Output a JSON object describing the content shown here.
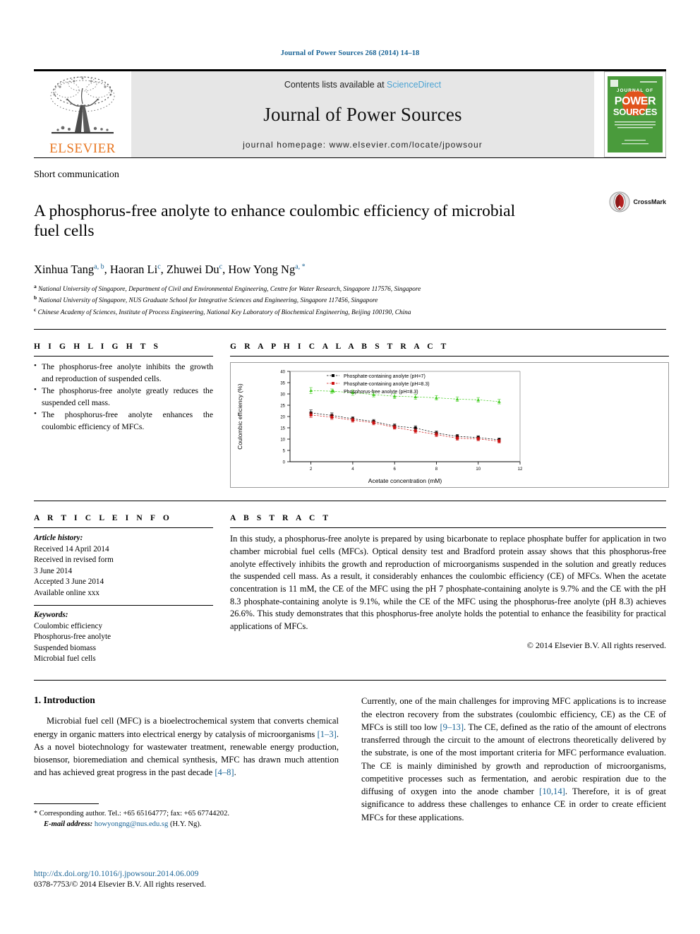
{
  "running_head": "Journal of Power Sources 268 (2014) 14–18",
  "masthead": {
    "contents_prefix": "Contents lists available at",
    "sciencedirect": "ScienceDirect",
    "journal_name": "Journal of Power Sources",
    "homepage": "journal homepage: www.elsevier.com/locate/jpowsour",
    "publisher_wordmark": "ELSEVIER",
    "cover": {
      "line1": "JOURNAL OF",
      "line2": "POWER",
      "line3": "SOURCES"
    }
  },
  "article": {
    "category": "Short communication",
    "title": "A phosphorus-free anolyte to enhance coulombic efficiency of microbial fuel cells",
    "crossmark_label": "CrossMark",
    "authors_html": "Xinhua Tang, Haoran Li, Zhuwei Du, How Yong Ng",
    "authors": [
      {
        "name": "Xinhua Tang",
        "marks": "a, b"
      },
      {
        "name": "Haoran Li",
        "marks": "c"
      },
      {
        "name": "Zhuwei Du",
        "marks": "c"
      },
      {
        "name": "How Yong Ng",
        "marks": "a, *"
      }
    ],
    "affiliations": [
      {
        "mark": "a",
        "text": "National University of Singapore, Department of Civil and Environmental Engineering, Centre for Water Research, Singapore 117576, Singapore"
      },
      {
        "mark": "b",
        "text": "National University of Singapore, NUS Graduate School for Integrative Sciences and Engineering, Singapore 117456, Singapore"
      },
      {
        "mark": "c",
        "text": "Chinese Academy of Sciences, Institute of Process Engineering, National Key Laboratory of Biochemical Engineering, Beijing 100190, China"
      }
    ]
  },
  "highlights": {
    "heading": "H I G H L I G H T S",
    "items": [
      "The phosphorus-free anolyte inhibits the growth and reproduction of suspended cells.",
      "The phosphorus-free anolyte greatly reduces the suspended cell mass.",
      "The phosphorus-free anolyte enhances the coulombic efficiency of MFCs."
    ]
  },
  "graphical_abstract": {
    "heading": "G R A P H I C A L   A B S T R A C T"
  },
  "article_info": {
    "heading": "A R T I C L E   I N F O",
    "history_label": "Article history:",
    "history": [
      "Received 14 April 2014",
      "Received in revised form",
      "3 June 2014",
      "Accepted 3 June 2014",
      "Available online xxx"
    ],
    "keywords_label": "Keywords:",
    "keywords": [
      "Coulombic efficiency",
      "Phosphorus-free anolyte",
      "Suspended biomass",
      "Microbial fuel cells"
    ]
  },
  "abstract": {
    "heading": "A B S T R A C T",
    "text": "In this study, a phosphorus-free anolyte is prepared by using bicarbonate to replace phosphate buffer for application in two chamber microbial fuel cells (MFCs). Optical density test and Bradford protein assay shows that this phosphorus-free anolyte effectively inhibits the growth and reproduction of microorganisms suspended in the solution and greatly reduces the suspended cell mass. As a result, it considerably enhances the coulombic efficiency (CE) of MFCs. When the acetate concentration is 11 mM, the CE of the MFC using the pH 7 phosphate-containing anolyte is 9.7% and the CE with the pH 8.3 phosphate-containing anolyte is 9.1%, while the CE of the MFC using the phosphorus-free anolyte (pH 8.3) achieves 26.6%. This study demonstrates that this phosphorus-free anolyte holds the potential to enhance the feasibility for practical applications of MFCs.",
    "copyright": "© 2014 Elsevier B.V. All rights reserved."
  },
  "body": {
    "section_number_title": "1. Introduction",
    "left_paragraph_1": "Microbial fuel cell (MFC) is a bioelectrochemical system that converts chemical energy in organic matters into electrical energy by catalysis of microorganisms ",
    "left_ref_1": "[1–3]",
    "left_paragraph_1b": ". As a novel biotechnology for wastewater treatment, renewable energy production, biosensor, bioremediation and chemical synthesis, MFC has drawn much attention and has achieved great progress in the past decade ",
    "left_ref_2": "[4–8]",
    "left_paragraph_1c": ".",
    "right_paragraph_1": "Currently, one of the main challenges for improving MFC applications is to increase the electron recovery from the substrates (coulombic efficiency, CE) as the CE of MFCs is still too low ",
    "right_ref_1": "[9–13]",
    "right_paragraph_1b": ". The CE, defined as the ratio of the amount of electrons transferred through the circuit to the amount of electrons theoretically delivered by the substrate, is one of the most important criteria for MFC performance evaluation. The CE is mainly diminished by growth and reproduction of microorganisms, competitive processes such as fermentation, and aerobic respiration due to the diffusing of oxygen into the anode chamber ",
    "right_ref_2": "[10,14]",
    "right_paragraph_1c": ". Therefore, it is of great significance to address these challenges to enhance CE in order to create efficient MFCs for these applications."
  },
  "footnote": {
    "star": "*",
    "corresponding": "Corresponding author. Tel.: +65 65164777; fax: +65 67744202.",
    "email_label": "E-mail address:",
    "email": "howyongng@nus.edu.sg",
    "email_owner": "(H.Y. Ng)."
  },
  "footer": {
    "doi": "http://dx.doi.org/10.1016/j.jpowsour.2014.06.009",
    "issn": "0378-7753/© 2014 Elsevier B.V. All rights reserved."
  },
  "colors": {
    "link": "#1a6496",
    "sciencedirect": "#4ba3d3",
    "elsevier_orange": "#e87722",
    "cover_green": "#4a9b3c",
    "series_black": "#000000",
    "series_red": "#cc1111",
    "series_green": "#44cc22"
  },
  "chart_data": {
    "type": "line",
    "title": "",
    "xlabel": "Acetate concentration (mM)",
    "ylabel": "Coulombic efficiency (%)",
    "xlim": [
      1,
      12
    ],
    "ylim": [
      0,
      40
    ],
    "xticks": [
      2,
      4,
      6,
      8,
      10,
      12
    ],
    "yticks": [
      0,
      5,
      10,
      15,
      20,
      25,
      30,
      35,
      40
    ],
    "grid": false,
    "legend_position": "top-center",
    "x": [
      2,
      3,
      4,
      5,
      6,
      7,
      8,
      9,
      10,
      11
    ],
    "series": [
      {
        "name": "Phosphate-containing anolyte (pH=7)",
        "color": "#000000",
        "marker": "square",
        "values": [
          21.6,
          20.5,
          19.0,
          17.8,
          15.8,
          14.9,
          12.7,
          11.2,
          10.7,
          9.7
        ],
        "errors": [
          1.3,
          1.1,
          0.9,
          0.9,
          0.9,
          1.0,
          0.9,
          0.9,
          0.8,
          0.8
        ]
      },
      {
        "name": "Phosphate-containing anolyte (pH=8.3)",
        "color": "#cc1111",
        "marker": "square",
        "values": [
          20.7,
          19.7,
          18.4,
          17.2,
          15.2,
          13.6,
          12.0,
          10.4,
          10.1,
          9.1
        ],
        "errors": [
          1.1,
          1.0,
          0.9,
          0.9,
          0.8,
          0.9,
          0.9,
          0.9,
          0.8,
          0.8
        ]
      },
      {
        "name": "Phosphorus-free anolyte (pH=8.3)",
        "color": "#44cc22",
        "marker": "triangle",
        "values": [
          31.5,
          31.2,
          30.6,
          29.7,
          29.0,
          28.7,
          28.3,
          27.7,
          27.4,
          26.6
        ],
        "errors": [
          1.3,
          1.0,
          1.2,
          1.0,
          1.1,
          1.1,
          1.0,
          1.0,
          1.0,
          1.0
        ]
      }
    ]
  }
}
